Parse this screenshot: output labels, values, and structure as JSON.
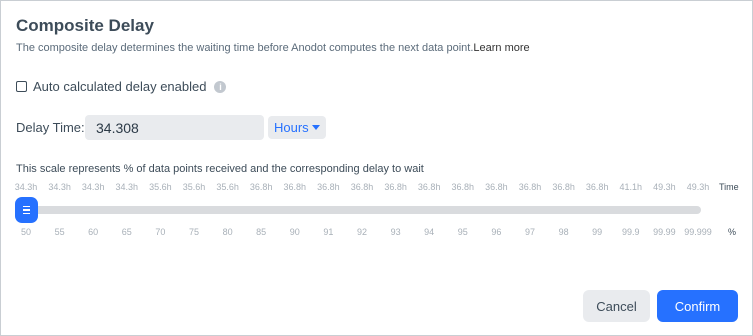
{
  "dialog": {
    "title": "Composite Delay",
    "description": "The composite delay determines the waiting time before Anodot computes the next data point.",
    "learn_more": "Learn more"
  },
  "auto_delay": {
    "label": "Auto calculated delay enabled",
    "checked": false,
    "info_icon": "i"
  },
  "delay_time": {
    "label": "Delay Time:",
    "value": "34.308",
    "unit": "Hours"
  },
  "scale": {
    "caption": "This scale represents % of data points received and the corresponding delay to wait",
    "time_ticks": [
      "34.3h",
      "34.3h",
      "34.3h",
      "34.3h",
      "35.6h",
      "35.6h",
      "35.6h",
      "36.8h",
      "36.8h",
      "36.8h",
      "36.8h",
      "36.8h",
      "36.8h",
      "36.8h",
      "36.8h",
      "36.8h",
      "36.8h",
      "36.8h",
      "41.1h",
      "49.3h",
      "49.3h"
    ],
    "time_unit": "Time",
    "percent_ticks": [
      "50",
      "55",
      "60",
      "65",
      "70",
      "75",
      "80",
      "85",
      "90",
      "91",
      "92",
      "93",
      "94",
      "95",
      "96",
      "97",
      "98",
      "99",
      "99.9",
      "99.99",
      "99.999"
    ],
    "percent_unit": "%",
    "selected_index": 0
  },
  "buttons": {
    "cancel": "Cancel",
    "confirm": "Confirm"
  },
  "colors": {
    "accent": "#2671ff",
    "track": "#d9dbde"
  }
}
